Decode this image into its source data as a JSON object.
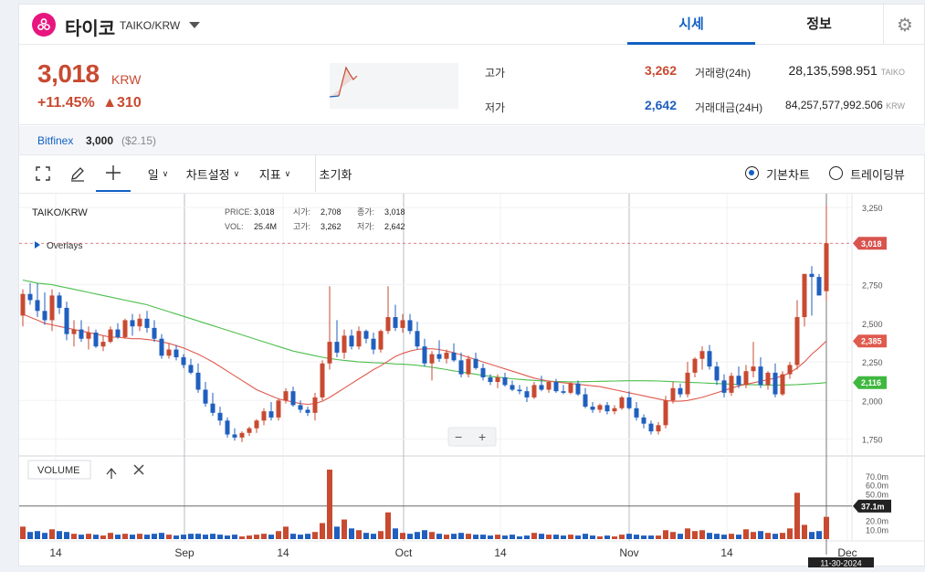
{
  "header": {
    "coin_name": "타이코",
    "pair": "TAIKO/KRW",
    "tabs": [
      {
        "label": "시세",
        "active": true
      },
      {
        "label": "정보",
        "active": false
      }
    ]
  },
  "price": {
    "current": "3,018",
    "currency": "KRW",
    "change_pct": "+11.45%",
    "change_arrow": "▲",
    "change_amt": "310",
    "high_label": "고가",
    "high": "3,262",
    "low_label": "저가",
    "low": "2,642",
    "vol_label": "거래량(24h)",
    "vol": "28,135,598.951",
    "vol_unit": "TAIKO",
    "amt_label": "거래대금(24H)",
    "amt": "84,257,577,992.506",
    "amt_unit": "KRW"
  },
  "bitfinex": {
    "name": "Bitfinex",
    "price": "3,000",
    "usd": "($2.15)"
  },
  "toolbar": {
    "interval": "일",
    "chart_settings": "차트설정",
    "indicators": "지표",
    "reset": "초기화",
    "basic_chart": "기본차트",
    "tradingview": "트레이딩뷰"
  },
  "legend": {
    "pair": "TAIKO/KRW",
    "overlays": "Overlays",
    "price_lbl": "PRICE:",
    "price": "3,018",
    "open_lbl": "시가:",
    "open": "2,708",
    "close_lbl": "종가:",
    "close": "3,018",
    "vol_lbl": "VOL:",
    "vol": "25.4M",
    "high_lbl": "고가:",
    "high": "3,262",
    "low_lbl": "저가:",
    "low": "2,642"
  },
  "volume_panel": {
    "label": "VOLUME",
    "current": "37.1m"
  },
  "colors": {
    "up": "#c84a31",
    "down": "#1f5fbf",
    "ma_short": "#e05a4e",
    "ma_long": "#4cbf4c",
    "accent": "#1261c4"
  },
  "chart_data": {
    "type": "candlestick",
    "price_axis": {
      "min": 1750,
      "max": 3250,
      "ticks": [
        "3,250",
        "2,750",
        "2,500",
        "2,250",
        "2,000",
        "1,750"
      ]
    },
    "volume_axis": {
      "ticks": [
        "70.0m",
        "60.0m",
        "50.0m",
        "20.0m",
        "10.0m"
      ]
    },
    "x_labels": [
      "14",
      "Sep",
      "14",
      "Oct",
      "14",
      "Nov",
      "14",
      "Dec"
    ],
    "last_date": "11-30-2024",
    "markers": {
      "price": "3,018",
      "ma_short": "2,385",
      "ma_long": "2,116"
    },
    "candles": [
      [
        2550,
        2720,
        2480,
        2690,
        14
      ],
      [
        2690,
        2760,
        2620,
        2650,
        8
      ],
      [
        2650,
        2760,
        2540,
        2580,
        9
      ],
      [
        2580,
        2700,
        2490,
        2520,
        7
      ],
      [
        2520,
        2720,
        2450,
        2680,
        11
      ],
      [
        2680,
        2700,
        2560,
        2600,
        9
      ],
      [
        2600,
        2640,
        2390,
        2430,
        8
      ],
      [
        2430,
        2520,
        2350,
        2460,
        6
      ],
      [
        2460,
        2520,
        2380,
        2400,
        5
      ],
      [
        2400,
        2480,
        2330,
        2440,
        6
      ],
      [
        2440,
        2460,
        2340,
        2350,
        5
      ],
      [
        2350,
        2420,
        2320,
        2380,
        4
      ],
      [
        2380,
        2480,
        2370,
        2460,
        7
      ],
      [
        2460,
        2500,
        2400,
        2410,
        5
      ],
      [
        2410,
        2530,
        2400,
        2520,
        6
      ],
      [
        2520,
        2560,
        2420,
        2480,
        5
      ],
      [
        2480,
        2560,
        2450,
        2530,
        6
      ],
      [
        2530,
        2580,
        2440,
        2470,
        5
      ],
      [
        2470,
        2520,
        2380,
        2400,
        6
      ],
      [
        2400,
        2430,
        2270,
        2290,
        7
      ],
      [
        2290,
        2370,
        2270,
        2330,
        5
      ],
      [
        2330,
        2360,
        2260,
        2280,
        4
      ],
      [
        2280,
        2300,
        2210,
        2230,
        5
      ],
      [
        2230,
        2270,
        2170,
        2180,
        6
      ],
      [
        2180,
        2240,
        2050,
        2070,
        6
      ],
      [
        2070,
        2120,
        1960,
        1980,
        5
      ],
      [
        1980,
        2050,
        1900,
        1920,
        6
      ],
      [
        1920,
        1960,
        1840,
        1870,
        5
      ],
      [
        1870,
        1890,
        1760,
        1780,
        4
      ],
      [
        1780,
        1820,
        1740,
        1760,
        5
      ],
      [
        1760,
        1800,
        1730,
        1790,
        3
      ],
      [
        1790,
        1830,
        1770,
        1820,
        4
      ],
      [
        1820,
        1880,
        1790,
        1870,
        5
      ],
      [
        1870,
        1950,
        1840,
        1930,
        6
      ],
      [
        1930,
        1990,
        1870,
        1890,
        5
      ],
      [
        1890,
        2010,
        1870,
        2000,
        9
      ],
      [
        2000,
        2080,
        1980,
        2060,
        14
      ],
      [
        2060,
        2090,
        1960,
        1970,
        6
      ],
      [
        1970,
        2000,
        1920,
        1940,
        5
      ],
      [
        1940,
        1960,
        1900,
        1920,
        6
      ],
      [
        1920,
        2050,
        1870,
        2020,
        8
      ],
      [
        2020,
        2260,
        2000,
        2240,
        18
      ],
      [
        2240,
        2740,
        2200,
        2380,
        78
      ],
      [
        2380,
        2520,
        2280,
        2310,
        14
      ],
      [
        2310,
        2460,
        2270,
        2420,
        22
      ],
      [
        2420,
        2460,
        2330,
        2350,
        12
      ],
      [
        2350,
        2480,
        2330,
        2450,
        10
      ],
      [
        2450,
        2460,
        2370,
        2400,
        7
      ],
      [
        2400,
        2440,
        2300,
        2330,
        6
      ],
      [
        2330,
        2460,
        2310,
        2450,
        9
      ],
      [
        2450,
        2740,
        2430,
        2540,
        30
      ],
      [
        2540,
        2620,
        2450,
        2470,
        12
      ],
      [
        2470,
        2560,
        2440,
        2520,
        7
      ],
      [
        2520,
        2560,
        2430,
        2450,
        6
      ],
      [
        2450,
        2510,
        2330,
        2350,
        8
      ],
      [
        2350,
        2400,
        2220,
        2240,
        10
      ],
      [
        2240,
        2320,
        2130,
        2300,
        8
      ],
      [
        2300,
        2390,
        2250,
        2270,
        6
      ],
      [
        2270,
        2330,
        2240,
        2310,
        5
      ],
      [
        2310,
        2370,
        2250,
        2260,
        6
      ],
      [
        2260,
        2310,
        2150,
        2170,
        7
      ],
      [
        2170,
        2290,
        2150,
        2270,
        6
      ],
      [
        2270,
        2310,
        2200,
        2210,
        5
      ],
      [
        2210,
        2240,
        2130,
        2150,
        5
      ],
      [
        2150,
        2170,
        2100,
        2120,
        4
      ],
      [
        2120,
        2170,
        2080,
        2150,
        5
      ],
      [
        2150,
        2180,
        2090,
        2100,
        4
      ],
      [
        2100,
        2130,
        2060,
        2070,
        5
      ],
      [
        2070,
        2100,
        2040,
        2060,
        3
      ],
      [
        2060,
        2090,
        1990,
        2020,
        4
      ],
      [
        2020,
        2120,
        2010,
        2100,
        7
      ],
      [
        2100,
        2160,
        2060,
        2070,
        6
      ],
      [
        2070,
        2130,
        2050,
        2120,
        5
      ],
      [
        2120,
        2140,
        2050,
        2060,
        5
      ],
      [
        2060,
        2100,
        2040,
        2050,
        4
      ],
      [
        2050,
        2120,
        2040,
        2110,
        5
      ],
      [
        2110,
        2130,
        2030,
        2040,
        4
      ],
      [
        2040,
        2080,
        1950,
        1960,
        6
      ],
      [
        1960,
        1990,
        1920,
        1940,
        4
      ],
      [
        1940,
        1980,
        1920,
        1970,
        3
      ],
      [
        1970,
        1990,
        1910,
        1930,
        4
      ],
      [
        1930,
        1970,
        1910,
        1950,
        3
      ],
      [
        1950,
        2030,
        1940,
        2020,
        5
      ],
      [
        2020,
        2060,
        1940,
        1950,
        6
      ],
      [
        1950,
        1990,
        1870,
        1890,
        5
      ],
      [
        1890,
        1910,
        1820,
        1850,
        4
      ],
      [
        1850,
        1870,
        1780,
        1800,
        4
      ],
      [
        1800,
        1860,
        1780,
        1840,
        4
      ],
      [
        1840,
        2030,
        1820,
        2000,
        10
      ],
      [
        2000,
        2120,
        1980,
        2080,
        8
      ],
      [
        2080,
        2110,
        2020,
        2040,
        6
      ],
      [
        2040,
        2250,
        2020,
        2180,
        12
      ],
      [
        2180,
        2280,
        2150,
        2270,
        9
      ],
      [
        2270,
        2350,
        2200,
        2320,
        10
      ],
      [
        2320,
        2360,
        2200,
        2220,
        7
      ],
      [
        2220,
        2250,
        2100,
        2130,
        6
      ],
      [
        2130,
        2170,
        2020,
        2050,
        5
      ],
      [
        2050,
        2180,
        2030,
        2160,
        6
      ],
      [
        2160,
        2220,
        2080,
        2100,
        5
      ],
      [
        2100,
        2230,
        2080,
        2190,
        11
      ],
      [
        2190,
        2380,
        2150,
        2220,
        8
      ],
      [
        2220,
        2280,
        2080,
        2100,
        9
      ],
      [
        2100,
        2190,
        2070,
        2180,
        7
      ],
      [
        2180,
        2240,
        2020,
        2040,
        6
      ],
      [
        2040,
        2190,
        2030,
        2170,
        7
      ],
      [
        2170,
        2250,
        2140,
        2230,
        12
      ],
      [
        2230,
        2650,
        2200,
        2540,
        52
      ],
      [
        2540,
        2800,
        2480,
        2820,
        16
      ],
      [
        2820,
        2870,
        2550,
        2800,
        8
      ],
      [
        2800,
        2820,
        2680,
        2680,
        9
      ],
      [
        2708,
        3262,
        2642,
        3018,
        25
      ]
    ],
    "ma_short": [
      2560,
      2540,
      2520,
      2500,
      2490,
      2480,
      2470,
      2460,
      2450,
      2440,
      2430,
      2420,
      2410,
      2410,
      2405,
      2400,
      2400,
      2395,
      2390,
      2380,
      2370,
      2355,
      2340,
      2320,
      2300,
      2275,
      2250,
      2220,
      2190,
      2160,
      2130,
      2100,
      2070,
      2050,
      2030,
      2010,
      2000,
      1990,
      1980,
      1975,
      1980,
      1995,
      2020,
      2050,
      2080,
      2110,
      2140,
      2170,
      2200,
      2225,
      2255,
      2285,
      2305,
      2320,
      2330,
      2335,
      2335,
      2330,
      2320,
      2310,
      2295,
      2280,
      2265,
      2250,
      2235,
      2220,
      2205,
      2190,
      2175,
      2160,
      2145,
      2135,
      2125,
      2120,
      2115,
      2110,
      2105,
      2100,
      2095,
      2090,
      2080,
      2070,
      2060,
      2050,
      2040,
      2030,
      2020,
      2010,
      2000,
      1995,
      1995,
      2000,
      2010,
      2020,
      2035,
      2050,
      2065,
      2080,
      2095,
      2105,
      2115,
      2125,
      2135,
      2145,
      2160,
      2180,
      2210,
      2250,
      2300,
      2340,
      2385
    ],
    "ma_long": [
      2780,
      2770,
      2760,
      2755,
      2750,
      2740,
      2730,
      2720,
      2710,
      2700,
      2690,
      2680,
      2670,
      2660,
      2650,
      2640,
      2630,
      2620,
      2605,
      2590,
      2575,
      2560,
      2545,
      2530,
      2515,
      2500,
      2485,
      2470,
      2455,
      2440,
      2425,
      2410,
      2395,
      2380,
      2365,
      2350,
      2335,
      2320,
      2310,
      2300,
      2290,
      2280,
      2272,
      2265,
      2260,
      2255,
      2250,
      2248,
      2245,
      2243,
      2240,
      2237,
      2235,
      2232,
      2228,
      2222,
      2215,
      2208,
      2200,
      2192,
      2185,
      2177,
      2170,
      2163,
      2157,
      2151,
      2146,
      2141,
      2137,
      2133,
      2130,
      2127,
      2125,
      2123,
      2122,
      2121,
      2121,
      2122,
      2123,
      2124,
      2125,
      2126,
      2127,
      2128,
      2128,
      2128,
      2127,
      2126,
      2124,
      2122,
      2120,
      2118,
      2116,
      2114,
      2112,
      2110,
      2108,
      2106,
      2104,
      2103,
      2102,
      2101,
      2100,
      2100,
      2100,
      2101,
      2103,
      2106,
      2109,
      2112,
      2116
    ]
  }
}
